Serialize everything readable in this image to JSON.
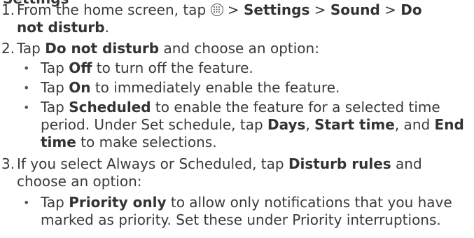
{
  "heading_fragment": "Settings",
  "steps": [
    {
      "number": "1.",
      "pre": "From the home screen, tap",
      "sep1": " > ",
      "b1": "Settings",
      "sep2": " > ",
      "b2": "Sound",
      "sep3": " > ",
      "b3a": "Do",
      "b3b": "not disturb",
      "end": "."
    },
    {
      "number": "2.",
      "pre": "Tap ",
      "b1": "Do not disturb",
      "post": " and choose an option:",
      "bullets": [
        {
          "pre": "Tap ",
          "b": "Off",
          "post": " to turn off the feature."
        },
        {
          "pre": "Tap ",
          "b": "On",
          "post": " to immediately enable the feature."
        },
        {
          "pre": "Tap ",
          "b": "Scheduled",
          "post": " to enable the feature for a selected time",
          "line2_pre": "period. Under Set schedule, tap ",
          "b2": "Days",
          "sep2": ", ",
          "b3": "Start time",
          "sep3": ", and ",
          "b4a": "End",
          "b4b": "time",
          "line3_post": " to make selections."
        }
      ]
    },
    {
      "number": "3.",
      "line1": "If you select Always or Scheduled, tap ",
      "b1": "Disturb rules",
      "line1_post": " and",
      "line2": "choose an option:",
      "bullets": [
        {
          "pre": "Tap ",
          "b": "Priority only",
          "post": " to allow only notifications that you have",
          "line2": "marked as priority. Set these under Priority interruptions."
        }
      ]
    }
  ],
  "icons": {
    "apps": "apps-grid-icon"
  }
}
